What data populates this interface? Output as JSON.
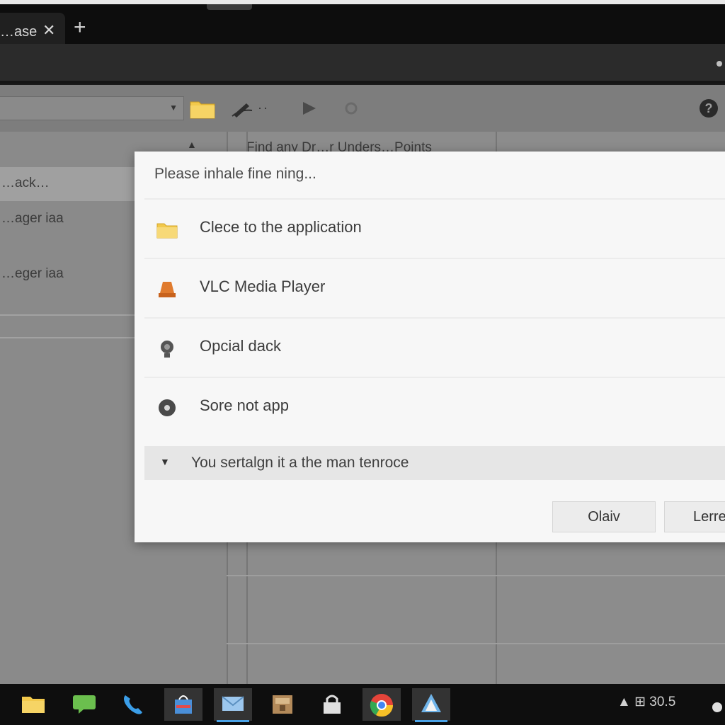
{
  "browser": {
    "tab_title": "…ase",
    "tab_close": "✕",
    "new_tab": "+"
  },
  "toolbar": {
    "ellipsis": "··",
    "help": "?"
  },
  "left_pane": {
    "items": [
      "…ack…",
      "…ager iaa",
      "…eger iaa"
    ]
  },
  "list": {
    "header": "Find any Dr…r Unders…Points"
  },
  "dialog": {
    "title": "Please inhale fine ning...",
    "options": [
      {
        "label": "Clece to the application",
        "icon": "folder-icon"
      },
      {
        "label": "VLC Media Player",
        "icon": "vlc-icon"
      },
      {
        "label": "Opcial dack",
        "icon": "gear-icon"
      },
      {
        "label": "Sore not app",
        "icon": "circle-icon"
      }
    ],
    "more_caret": "▼",
    "more_label": "You sertalgn it a the man tenroce",
    "ok_button": "Olaiv",
    "cancel_button": "Lerre"
  },
  "taskbar": {
    "apps": [
      "file-explorer-icon",
      "chat-icon",
      "phone-icon",
      "store-icon",
      "mail-icon",
      "archive-icon",
      "lock-icon",
      "chrome-icon",
      "maps-icon"
    ],
    "tray_text": "▲ ⊞ 30.5"
  },
  "colors": {
    "accent": "#4aa3e8",
    "dialog_bg": "#f7f7f7",
    "folder": "#f2c94c",
    "vlc": "#e07b2e"
  }
}
